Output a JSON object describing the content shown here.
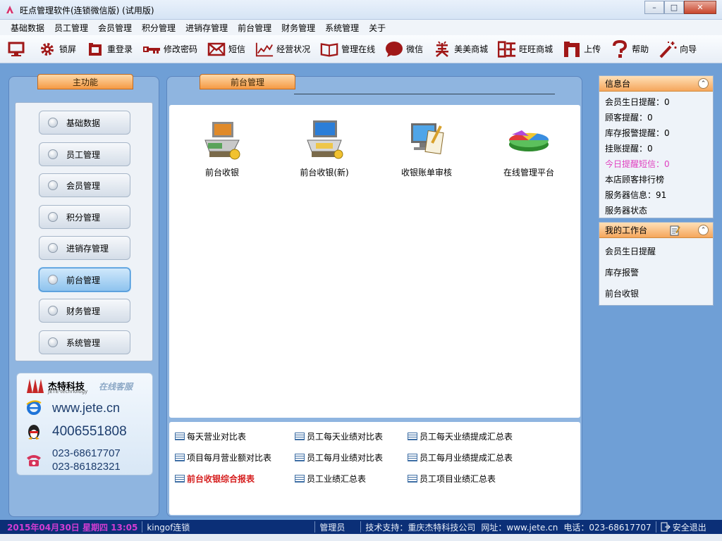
{
  "window": {
    "title": "旺点管理软件(连锁微信版)  (试用版)",
    "min_symbol": "–",
    "max_symbol": "□",
    "close_symbol": "✕"
  },
  "menu": [
    "基础数据",
    "员工管理",
    "会员管理",
    "积分管理",
    "进销存管理",
    "前台管理",
    "财务管理",
    "系统管理",
    "关于"
  ],
  "toolbar": [
    {
      "label": "",
      "icon": "monitor-icon"
    },
    {
      "label": "锁屏",
      "icon": "gear-icon"
    },
    {
      "label": "重登录",
      "icon": "relogin-icon"
    },
    {
      "label": "修改密码",
      "icon": "key-icon"
    },
    {
      "label": "短信",
      "icon": "envelope-icon"
    },
    {
      "label": "经营状况",
      "icon": "chart-line-icon"
    },
    {
      "label": "管理在线",
      "icon": "book-icon"
    },
    {
      "label": "微信",
      "icon": "chat-bubble-icon"
    },
    {
      "label": "美美商城",
      "icon": "mei-char-icon"
    },
    {
      "label": "旺旺商城",
      "icon": "wang-char-icon"
    },
    {
      "label": "上传",
      "icon": "upload-icon"
    },
    {
      "label": "帮助",
      "icon": "question-icon"
    },
    {
      "label": "向导",
      "icon": "wand-icon"
    }
  ],
  "left_panel": {
    "tab": "主功能",
    "items": [
      "基础数据",
      "员工管理",
      "会员管理",
      "积分管理",
      "进销存管理",
      "前台管理",
      "财务管理",
      "系统管理"
    ],
    "active_index": 5
  },
  "ad": {
    "brand": "杰特科技",
    "brand_sub": "JETE·technology",
    "service": "在线客服",
    "website": "www.jete.cn",
    "qq": "4006551808",
    "phone1": "023-68617707",
    "phone2": "023-86182321"
  },
  "center": {
    "tab": "前台管理",
    "icons": [
      {
        "label": "前台收银",
        "icon": "cashier-icon"
      },
      {
        "label": "前台收银(新)",
        "icon": "cashier-new-icon"
      },
      {
        "label": "收银账单审核",
        "icon": "bill-audit-icon"
      },
      {
        "label": "在线管理平台",
        "icon": "pie-chart-icon"
      }
    ],
    "reports": [
      {
        "label": "每天营业对比表",
        "bold": false
      },
      {
        "label": "员工每天业绩对比表",
        "bold": false
      },
      {
        "label": "员工每天业绩提成汇总表",
        "bold": false
      },
      {
        "label": "项目每月营业额对比表",
        "bold": false
      },
      {
        "label": "员工每月业绩对比表",
        "bold": false
      },
      {
        "label": "员工每月业绩提成汇总表",
        "bold": false
      },
      {
        "label": "前台收银综合报表",
        "bold": true
      },
      {
        "label": "员工业绩汇总表",
        "bold": false
      },
      {
        "label": "员工项目业绩汇总表",
        "bold": false
      }
    ]
  },
  "info": {
    "title": "信息台",
    "collapse_symbol": "⌃",
    "items": [
      {
        "label": "会员生日提醒：0",
        "highlight": false
      },
      {
        "label": "顾客提醒：0",
        "highlight": false
      },
      {
        "label": "库存报警提醒：0",
        "highlight": false
      },
      {
        "label": "挂账提醒：0",
        "highlight": false
      },
      {
        "label": "今日提醒短信：0",
        "highlight": true
      },
      {
        "label": "本店顾客排行榜",
        "highlight": false
      },
      {
        "label": "服务器信息：91",
        "highlight": false
      },
      {
        "label": "服务器状态",
        "highlight": false
      }
    ]
  },
  "workbench": {
    "title": "我的工作台",
    "collapse_symbol": "⌃",
    "items": [
      "会员生日提醒",
      "库存报警",
      "前台收银"
    ]
  },
  "status": {
    "date": "2015年04月30日  星期四  13:05",
    "user": "kingof连锁",
    "role": "管理员",
    "support": "技术支持：重庆杰特科技公司",
    "site": "网址：www.jete.cn",
    "phone": "电话：023-68617707",
    "logout": "安全退出"
  }
}
